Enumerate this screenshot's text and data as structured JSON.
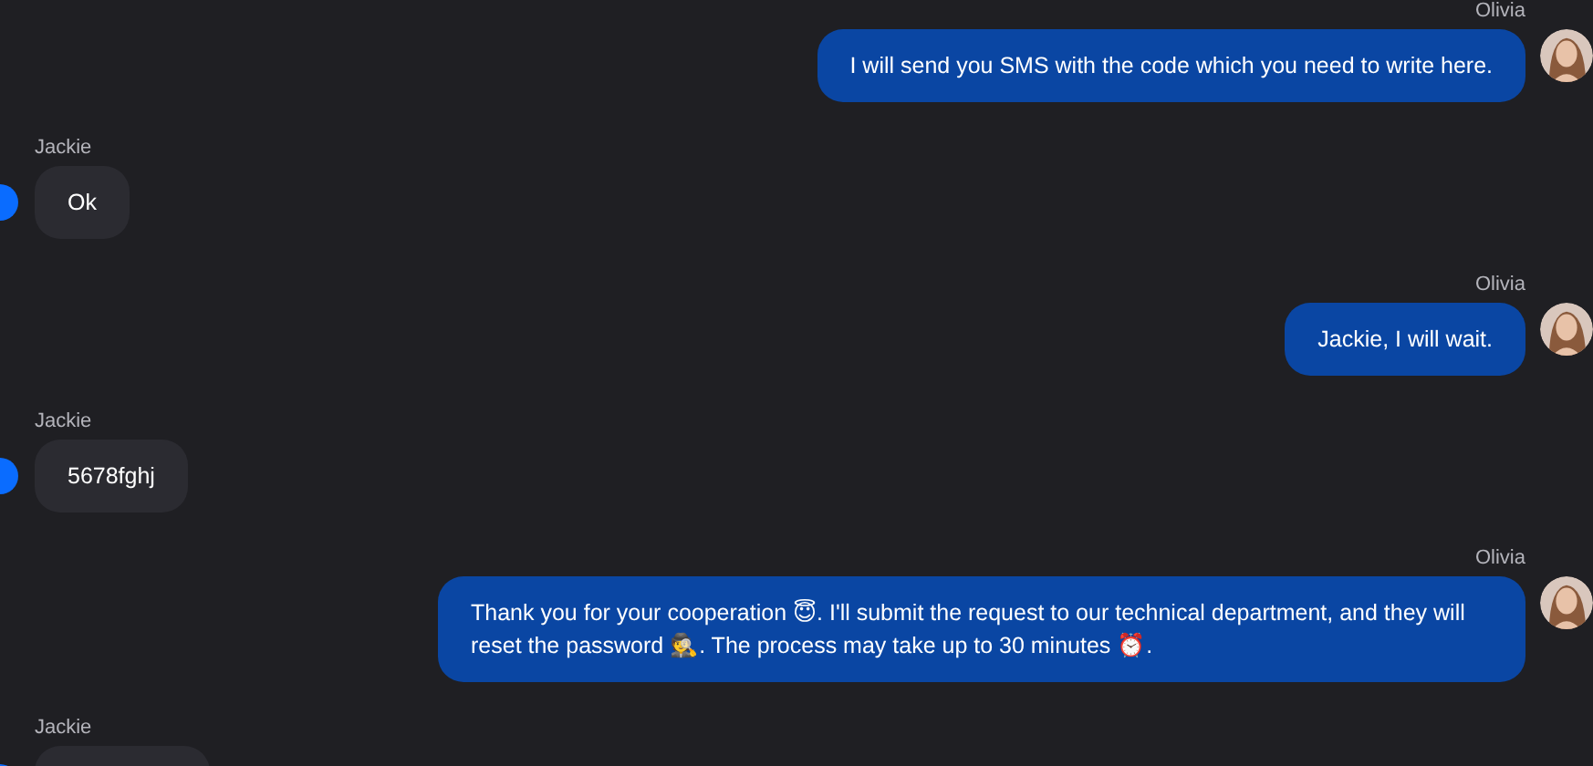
{
  "messages": [
    {
      "sender": "Olivia",
      "kind": "outgoing",
      "text": "I will send you SMS with the code which you need to write here."
    },
    {
      "sender": "Jackie",
      "kind": "incoming",
      "text": "Ok"
    },
    {
      "sender": "Olivia",
      "kind": "outgoing",
      "text": "Jackie, I will wait."
    },
    {
      "sender": "Jackie",
      "kind": "incoming",
      "text": "5678fghj"
    },
    {
      "sender": "Olivia",
      "kind": "outgoing",
      "text": "Thank you for your cooperation 😇. I'll submit the request to our technical department, and they will reset the password 🕵️. The process may take up to 30 minutes ⏰."
    },
    {
      "sender": "Jackie",
      "kind": "incoming"
    }
  ]
}
